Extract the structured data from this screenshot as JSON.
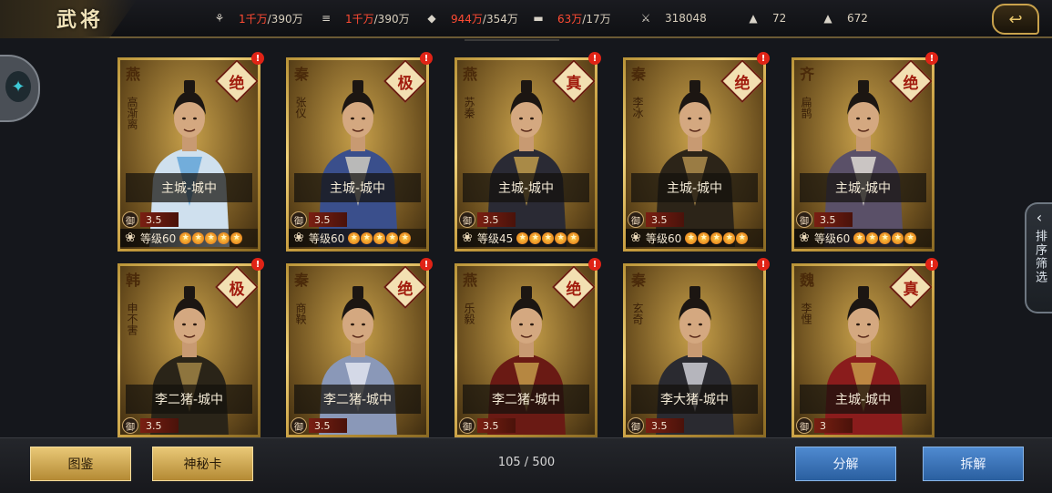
{
  "header": {
    "title": "武将",
    "resources": [
      {
        "icon": "wheat-icon",
        "current": "1千万",
        "max": "/390万",
        "red": true
      },
      {
        "icon": "wood-log-icon",
        "current": "1千万",
        "max": "/390万",
        "red": true
      },
      {
        "icon": "stone-icon",
        "current": "944万",
        "max": "/354万",
        "red": true
      },
      {
        "icon": "iron-ingot-icon",
        "current": "63万",
        "max": "/17万",
        "red": true
      },
      {
        "icon": "token-icon",
        "current": "318048",
        "max": "",
        "red": false
      },
      {
        "icon": "gold-ingot-icon",
        "current": "72",
        "max": "",
        "red": false
      },
      {
        "icon": "silver-ingot-icon",
        "current": "672",
        "max": "",
        "red": false
      }
    ],
    "back_icon": "back-arrow-icon"
  },
  "side_panel": {
    "label": "排序筛选"
  },
  "cards": [
    {
      "nation": "燕",
      "name": "高渐离",
      "grade": "绝",
      "location": "主城-城中",
      "defense": "3.5",
      "level": "等级60",
      "stars": 5,
      "robe": "#cfe0ee",
      "accent": "#5aa0d6"
    },
    {
      "nation": "秦",
      "name": "张仪",
      "grade": "极",
      "location": "主城-城中",
      "defense": "3.5",
      "level": "等级60",
      "stars": 5,
      "robe": "#3a4f8c",
      "accent": "#d9d3c3"
    },
    {
      "nation": "燕",
      "name": "苏秦",
      "grade": "真",
      "location": "主城-城中",
      "defense": "3.5",
      "level": "等级45",
      "stars": 5,
      "robe": "#2a2a34",
      "accent": "#c9a24c"
    },
    {
      "nation": "秦",
      "name": "李冰",
      "grade": "绝",
      "location": "主城-城中",
      "defense": "3.5",
      "level": "等级60",
      "stars": 5,
      "robe": "#2c2418",
      "accent": "#b69250"
    },
    {
      "nation": "齐",
      "name": "扁鹊",
      "grade": "绝",
      "location": "主城-城中",
      "defense": "3.5",
      "level": "等级60",
      "stars": 5,
      "robe": "#5a5068",
      "accent": "#e6e2da"
    },
    {
      "nation": "韩",
      "name": "申不害",
      "grade": "极",
      "location": "李二猪-城中",
      "defense": "3.5",
      "level": "",
      "stars": 0,
      "robe": "#2a2418",
      "accent": "#a88a48"
    },
    {
      "nation": "秦",
      "name": "商鞅",
      "grade": "绝",
      "location": "李二猪-城中",
      "defense": "3.5",
      "level": "",
      "stars": 0,
      "robe": "#8a98b8",
      "accent": "#e6eaf2"
    },
    {
      "nation": "燕",
      "name": "乐毅",
      "grade": "绝",
      "location": "李二猪-城中",
      "defense": "3.5",
      "level": "",
      "stars": 0,
      "robe": "#6a1a14",
      "accent": "#c9a24c"
    },
    {
      "nation": "秦",
      "name": "玄奇",
      "grade": "",
      "location": "李大猪-城中",
      "defense": "3.5",
      "level": "",
      "stars": 0,
      "robe": "#2a2a30",
      "accent": "#d8d8e0"
    },
    {
      "nation": "魏",
      "name": "李悝",
      "grade": "真",
      "location": "主城-城中",
      "defense": "3",
      "level": "",
      "stars": 0,
      "robe": "#8a1c1c",
      "accent": "#c9a24c"
    }
  ],
  "bottom": {
    "btn_gallery": "图鉴",
    "btn_mystery": "神秘卡",
    "counter": "105 / 500",
    "btn_decompose": "分解",
    "btn_dismantle": "拆解"
  },
  "labels": {
    "defense_char": "御",
    "alert": "!"
  }
}
